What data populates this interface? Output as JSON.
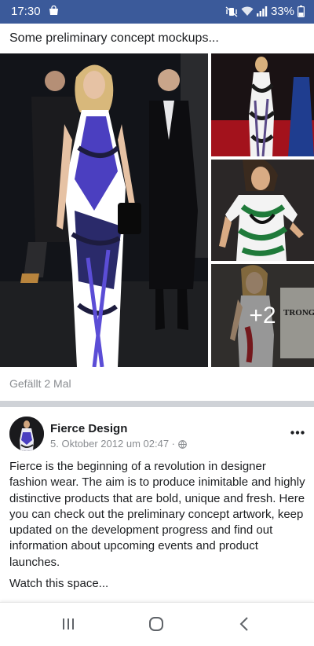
{
  "status": {
    "time": "17:30",
    "battery": "33%",
    "icons": [
      "shopping-bag-icon",
      "mute-vibrate-icon",
      "wifi-icon",
      "signal-icon",
      "battery-icon"
    ]
  },
  "post": {
    "caption": "Some preliminary concept mockups...",
    "photos": {
      "more_count": "+2",
      "sign_text": "TRONG"
    },
    "likes": "Gefällt 2 Mal"
  },
  "next_post": {
    "page_name": "Fierce Design",
    "meta": "5. Oktober 2012 um 02:47 ·",
    "body": "Fierce is the beginning of a revolution in designer fashion wear. The aim is to produce inimitable and highly distinctive products that are bold, unique and fresh. Here you can check out the preliminary concept artwork, keep updated on the development progress and find out information about upcoming events and product launches.",
    "extra": "Watch this space..."
  },
  "nav": {
    "icons": [
      "recent-apps-icon",
      "home-icon",
      "back-icon"
    ]
  },
  "colors": {
    "status_bar": "#3b5a9a",
    "muted_text": "#8a8d91",
    "separator": "#cfd2d7"
  }
}
